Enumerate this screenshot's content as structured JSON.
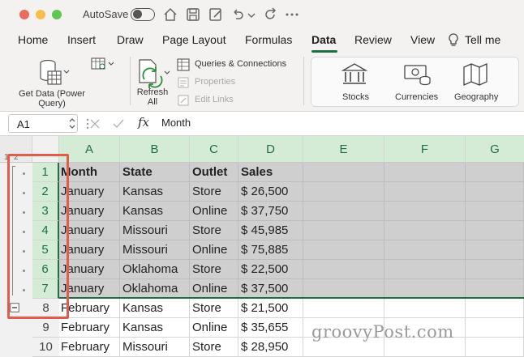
{
  "titlebar": {
    "autosave_label": "AutoSave"
  },
  "menu": {
    "tabs": [
      {
        "label": "Home"
      },
      {
        "label": "Insert"
      },
      {
        "label": "Draw"
      },
      {
        "label": "Page Layout"
      },
      {
        "label": "Formulas"
      },
      {
        "label": "Data"
      },
      {
        "label": "Review"
      },
      {
        "label": "View"
      },
      {
        "label": "Tell me"
      }
    ],
    "active": "Data"
  },
  "ribbon": {
    "get_data": "Get Data (Power Query)",
    "refresh_all": "Refresh All",
    "queries_connections": "Queries & Connections",
    "properties": "Properties",
    "edit_links": "Edit Links",
    "data_types": [
      {
        "label": "Stocks"
      },
      {
        "label": "Currencies"
      },
      {
        "label": "Geography"
      }
    ]
  },
  "formula_bar": {
    "cell_ref": "A1",
    "fx": "fx",
    "value": "Month"
  },
  "outline": {
    "levels": [
      "1",
      "2"
    ]
  },
  "columns": [
    "A",
    "B",
    "C",
    "D",
    "E",
    "F",
    "G"
  ],
  "rows": [
    {
      "num": "1",
      "cells": [
        "Month",
        "State",
        "Outlet",
        "Sales"
      ]
    },
    {
      "num": "2",
      "cells": [
        "January",
        "Kansas",
        "Store",
        "$ 26,500"
      ]
    },
    {
      "num": "3",
      "cells": [
        "January",
        "Kansas",
        "Online",
        "$ 37,750"
      ]
    },
    {
      "num": "4",
      "cells": [
        "January",
        "Missouri",
        "Store",
        "$ 45,985"
      ]
    },
    {
      "num": "5",
      "cells": [
        "January",
        "Missouri",
        "Online",
        "$ 75,885"
      ]
    },
    {
      "num": "6",
      "cells": [
        "January",
        "Oklahoma",
        "Store",
        "$ 22,500"
      ]
    },
    {
      "num": "7",
      "cells": [
        "January",
        "Oklahoma",
        "Online",
        "$ 37,500"
      ]
    },
    {
      "num": "8",
      "cells": [
        "February",
        "Kansas",
        "Store",
        "$ 21,500"
      ]
    },
    {
      "num": "9",
      "cells": [
        "February",
        "Kansas",
        "Online",
        "$ 35,655"
      ]
    },
    {
      "num": "10",
      "cells": [
        "February",
        "Missouri",
        "Store",
        "$ 28,950"
      ]
    }
  ],
  "watermark": "groovyPost.com",
  "colors": {
    "accent": "#1d6f42",
    "highlight": "#e25c4a",
    "selection": "#cfcfcf"
  }
}
